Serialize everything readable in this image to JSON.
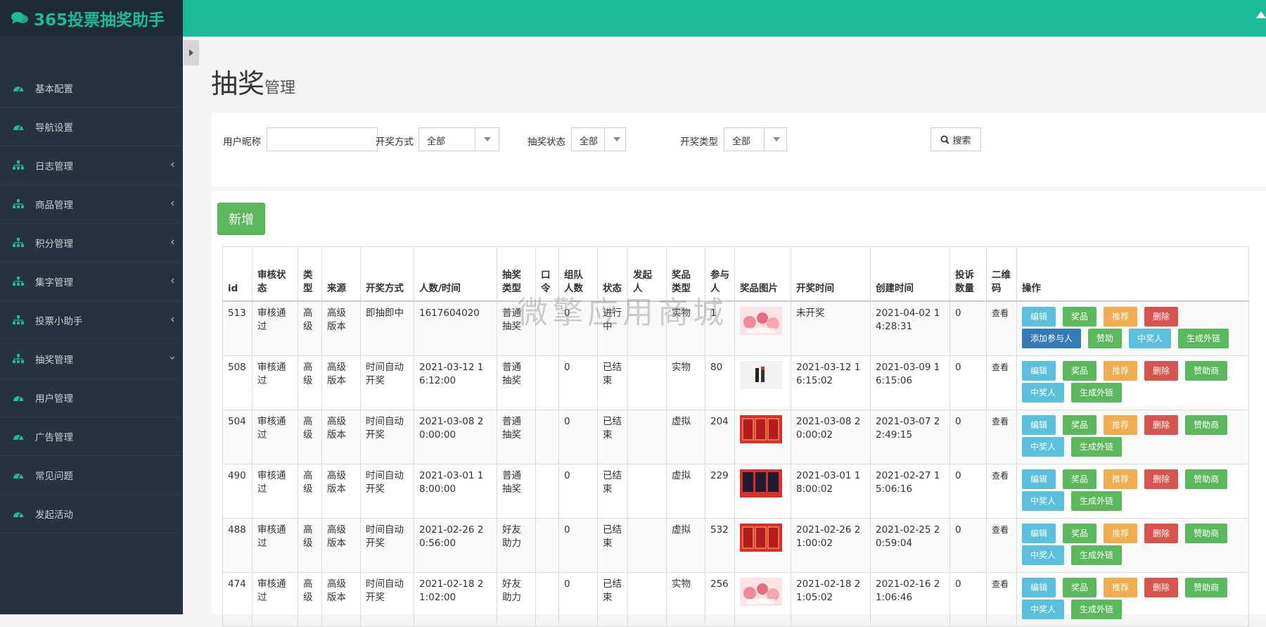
{
  "brand": {
    "title": "365投票抽奖助手",
    "icon": "comments-icon"
  },
  "sidebar": {
    "items": [
      {
        "label": "基本配置",
        "icon": "dashboard-icon",
        "has_chevron": false
      },
      {
        "label": "导航设置",
        "icon": "dashboard-icon",
        "has_chevron": false
      },
      {
        "label": "日志管理",
        "icon": "sitemap-icon",
        "has_chevron": true
      },
      {
        "label": "商品管理",
        "icon": "sitemap-icon",
        "has_chevron": true
      },
      {
        "label": "积分管理",
        "icon": "sitemap-icon",
        "has_chevron": true
      },
      {
        "label": "集字管理",
        "icon": "sitemap-icon",
        "has_chevron": true
      },
      {
        "label": "投票小助手",
        "icon": "sitemap-icon",
        "has_chevron": true
      },
      {
        "label": "抽奖管理",
        "icon": "sitemap-icon",
        "has_chevron": true,
        "expanded": true
      },
      {
        "label": "用户管理",
        "icon": "dashboard-icon",
        "has_chevron": false
      },
      {
        "label": "广告管理",
        "icon": "dashboard-icon",
        "has_chevron": false
      },
      {
        "label": "常见问题",
        "icon": "dashboard-icon",
        "has_chevron": false
      },
      {
        "label": "发起活动",
        "icon": "dashboard-icon",
        "has_chevron": false
      }
    ]
  },
  "page": {
    "title": "抽奖",
    "subtitle": "管理"
  },
  "filters": {
    "nickname_label": "用户昵称",
    "nickname_value": "",
    "draw_method_label": "开奖方式",
    "draw_method_value": "全部",
    "status_label": "抽奖状态",
    "status_value": "全部",
    "draw_type_label": "开奖类型",
    "draw_type_value": "全部",
    "search_label": "搜索"
  },
  "add_button": "新增",
  "table": {
    "headers": [
      "id",
      "审核状态",
      "类型",
      "来源",
      "开奖方式",
      "人数/时间",
      "抽奖类型",
      "口令",
      "组队人数",
      "状态",
      "发起人",
      "奖品类型",
      "参与人",
      "奖品图片",
      "开奖时间",
      "创建时间",
      "投诉数量",
      "二维码",
      "操作"
    ],
    "rows": [
      {
        "id": "513",
        "audit": "审核通过",
        "type": "高级",
        "source": "高级版本",
        "method": "即抽即中",
        "people_time": "1617604020",
        "lottery_type": "普通抽奖",
        "code": "",
        "team": "0",
        "status": "进行中",
        "initiator": "",
        "prize_type": "实物",
        "participants": "1",
        "image": "pink-gift-image",
        "draw_time": "未开奖",
        "create_time": "2021-04-02 14:28:31",
        "complaints": "0",
        "qrcode": "查看",
        "ops": [
          [
            "编辑",
            "info"
          ],
          [
            "奖品",
            "success"
          ],
          [
            "推荐",
            "warning"
          ],
          [
            "删除",
            "danger"
          ],
          [
            "添加参与人",
            "primary"
          ],
          [
            "赞助",
            "success"
          ],
          [
            "中奖人",
            "info"
          ],
          [
            "生成外链",
            "success"
          ]
        ]
      },
      {
        "id": "508",
        "audit": "审核通过",
        "type": "高级",
        "source": "高级版本",
        "method": "时间自动开奖",
        "people_time": "2021-03-12 16:12:00",
        "lottery_type": "普通抽奖",
        "code": "",
        "team": "0",
        "status": "已结束",
        "initiator": "",
        "prize_type": "实物",
        "participants": "80",
        "image": "lipstick-image",
        "draw_time": "2021-03-12 16:15:02",
        "create_time": "2021-03-09 16:15:06",
        "complaints": "0",
        "qrcode": "查看",
        "ops": [
          [
            "编辑",
            "info"
          ],
          [
            "奖品",
            "success"
          ],
          [
            "推荐",
            "warning"
          ],
          [
            "删除",
            "danger"
          ],
          [
            "赞助商",
            "success"
          ],
          [
            "中奖人",
            "info"
          ],
          [
            "生成外链",
            "success"
          ]
        ]
      },
      {
        "id": "504",
        "audit": "审核通过",
        "type": "高级",
        "source": "高级版本",
        "method": "时间自动开奖",
        "people_time": "2021-03-08 20:00:00",
        "lottery_type": "普通抽奖",
        "code": "",
        "team": "0",
        "status": "已结束",
        "initiator": "",
        "prize_type": "虚拟",
        "participants": "204",
        "image": "red-cards-image",
        "draw_time": "2021-03-08 20:00:02",
        "create_time": "2021-03-07 22:49:15",
        "complaints": "0",
        "qrcode": "查看",
        "ops": [
          [
            "编辑",
            "info"
          ],
          [
            "奖品",
            "success"
          ],
          [
            "推荐",
            "warning"
          ],
          [
            "删除",
            "danger"
          ],
          [
            "赞助商",
            "success"
          ],
          [
            "中奖人",
            "info"
          ],
          [
            "生成外链",
            "success"
          ]
        ]
      },
      {
        "id": "490",
        "audit": "审核通过",
        "type": "高级",
        "source": "高级版本",
        "method": "时间自动开奖",
        "people_time": "2021-03-01 18:00:00",
        "lottery_type": "普通抽奖",
        "code": "",
        "team": "0",
        "status": "已结束",
        "initiator": "",
        "prize_type": "虚拟",
        "participants": "229",
        "image": "dark-cards-image",
        "draw_time": "2021-03-01 18:00:02",
        "create_time": "2021-02-27 15:06:16",
        "complaints": "0",
        "qrcode": "查看",
        "ops": [
          [
            "编辑",
            "info"
          ],
          [
            "奖品",
            "success"
          ],
          [
            "推荐",
            "warning"
          ],
          [
            "删除",
            "danger"
          ],
          [
            "赞助商",
            "success"
          ],
          [
            "中奖人",
            "info"
          ],
          [
            "生成外链",
            "success"
          ]
        ]
      },
      {
        "id": "488",
        "audit": "审核通过",
        "type": "高级",
        "source": "高级版本",
        "method": "时间自动开奖",
        "people_time": "2021-02-26 20:56:00",
        "lottery_type": "好友助力",
        "code": "",
        "team": "0",
        "status": "已结束",
        "initiator": "",
        "prize_type": "虚拟",
        "participants": "532",
        "image": "red-cards-image",
        "draw_time": "2021-02-26 21:00:02",
        "create_time": "2021-02-25 20:59:04",
        "complaints": "0",
        "qrcode": "查看",
        "ops": [
          [
            "编辑",
            "info"
          ],
          [
            "奖品",
            "success"
          ],
          [
            "推荐",
            "warning"
          ],
          [
            "删除",
            "danger"
          ],
          [
            "赞助商",
            "success"
          ],
          [
            "中奖人",
            "info"
          ],
          [
            "生成外链",
            "success"
          ]
        ]
      },
      {
        "id": "474",
        "audit": "审核通过",
        "type": "高级",
        "source": "高级版本",
        "method": "时间自动开奖",
        "people_time": "2021-02-18 21:02:00",
        "lottery_type": "好友助力",
        "code": "",
        "team": "0",
        "status": "已结束",
        "initiator": "",
        "prize_type": "实物",
        "participants": "256",
        "image": "pink-gift-image",
        "draw_time": "2021-02-18 21:05:02",
        "create_time": "2021-02-16 21:06:46",
        "complaints": "0",
        "qrcode": "查看",
        "ops": [
          [
            "编辑",
            "info"
          ],
          [
            "奖品",
            "success"
          ],
          [
            "推荐",
            "warning"
          ],
          [
            "删除",
            "danger"
          ],
          [
            "赞助商",
            "success"
          ],
          [
            "中奖人",
            "info"
          ],
          [
            "生成外链",
            "success"
          ]
        ]
      }
    ]
  },
  "watermark": "微擎应用商城",
  "colors": {
    "topbar": "#1bbc9b",
    "sidebar": "#253240",
    "brand_text": "#1bbc9b"
  }
}
